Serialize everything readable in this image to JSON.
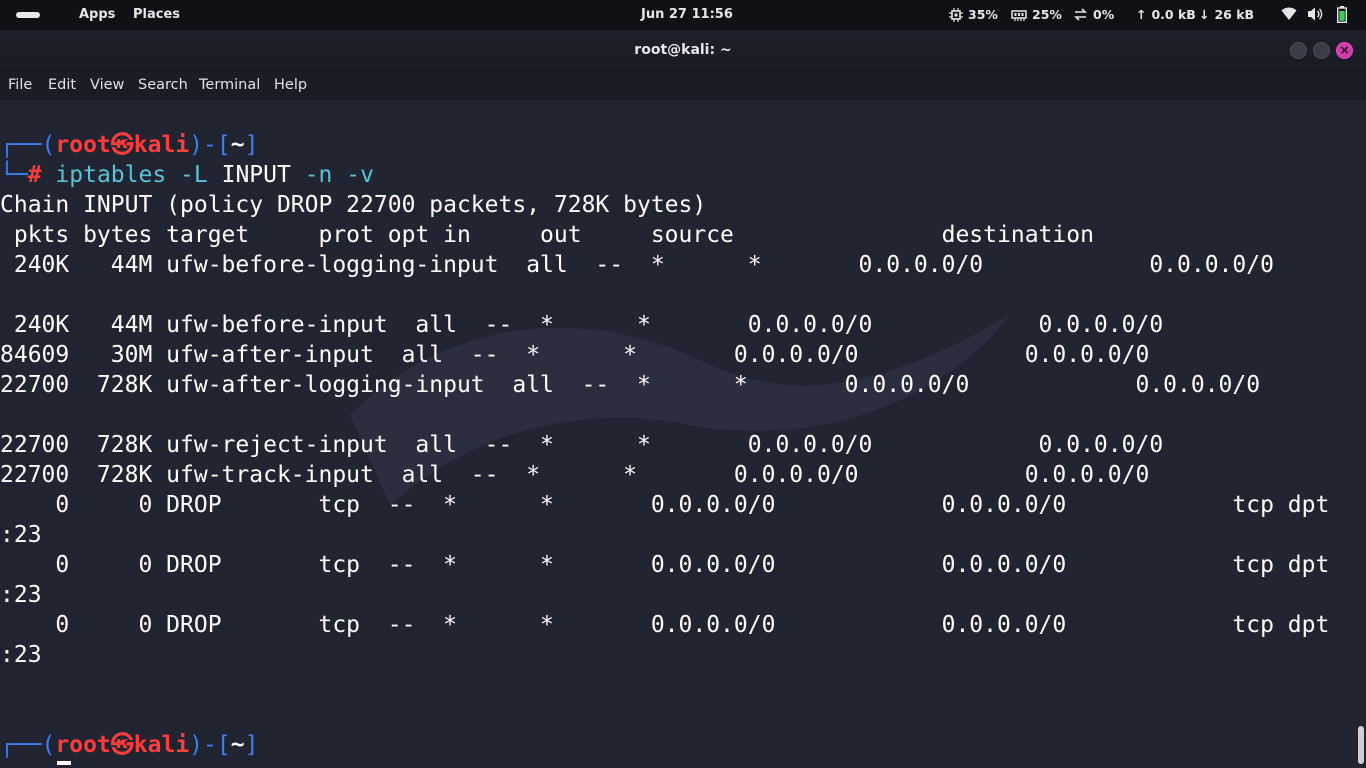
{
  "panel": {
    "apps_label": "Apps",
    "places_label": "Places",
    "clock": "Jun 27  11:56",
    "cpu": "35%",
    "mem": "25%",
    "swap": "0%",
    "net_up": "0.0 kB",
    "net_down": "26 kB"
  },
  "window": {
    "title": "root@kali: ~"
  },
  "menu": {
    "file": "File",
    "edit": "Edit",
    "view": "View",
    "search": "Search",
    "terminal": "Terminal",
    "help": "Help"
  },
  "prompt": {
    "box_open": "┌──(",
    "user": "root",
    "at_symbol": "㉿",
    "host": "kali",
    "box_mid": ")-[",
    "cwd": "~",
    "box_close": "]",
    "cmd_prefix": "└─",
    "hash": "#",
    "command": "iptables",
    "args_1": " -L ",
    "args_2": "INPUT",
    "args_3": " -n -v"
  },
  "output": [
    "Chain INPUT (policy DROP 22700 packets, 728K bytes)",
    " pkts bytes target     prot opt in     out     source               destination",
    " 240K   44M ufw-before-logging-input  all  --  *      *       0.0.0.0/0            0.0.0.0/0",
    "",
    " 240K   44M ufw-before-input  all  --  *      *       0.0.0.0/0            0.0.0.0/0",
    "84609   30M ufw-after-input  all  --  *      *       0.0.0.0/0            0.0.0.0/0",
    "22700  728K ufw-after-logging-input  all  --  *      *       0.0.0.0/0            0.0.0.0/0",
    "",
    "22700  728K ufw-reject-input  all  --  *      *       0.0.0.0/0            0.0.0.0/0",
    "22700  728K ufw-track-input  all  --  *      *       0.0.0.0/0            0.0.0.0/0",
    "    0     0 DROP       tcp  --  *      *       0.0.0.0/0            0.0.0.0/0            tcp dpt",
    ":23",
    "    0     0 DROP       tcp  --  *      *       0.0.0.0/0            0.0.0.0/0            tcp dpt",
    ":23",
    "    0     0 DROP       tcp  --  *      *       0.0.0.0/0            0.0.0.0/0            tcp dpt",
    ":23"
  ],
  "colors": {
    "prompt_blue": "#3f7df1",
    "prompt_red": "#ff3b3b",
    "command_cyan": "#56c3d8",
    "close_button": "#d03aa9"
  }
}
